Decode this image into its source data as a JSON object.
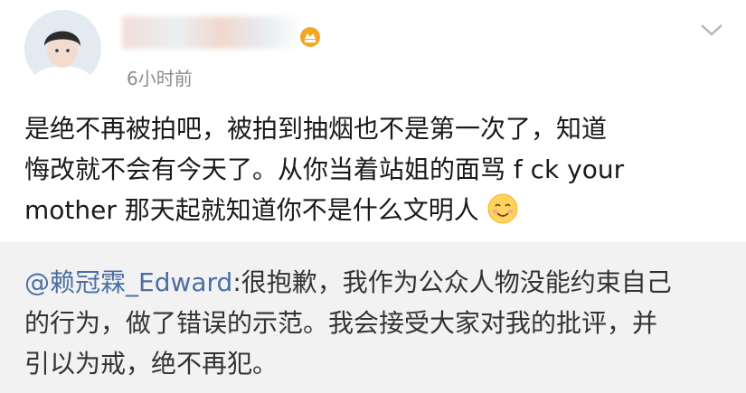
{
  "post": {
    "timestamp": "6小时前",
    "text_line1": "是绝不再被拍吧，被拍到抽烟也不是第一次了，知道",
    "text_line2": "悔改就不会有今天了。从你当着站姐的面骂 f ck your",
    "text_line3": "mother 那天起就知道你不是什么文明人",
    "emoji": "smiling-face-emoji"
  },
  "repost": {
    "mention": "@赖冠霖_Edward",
    "line1_rest": ":很抱歉，我作为公众人物没能约束自己",
    "line2": "的行为，做了错误的示范。我会接受大家对我的批评，并",
    "line3": "引以为戒，绝不再犯。"
  },
  "colors": {
    "mention": "#4a6fa5",
    "repost_bg": "#f2f2f2",
    "timestamp": "#8c8c8c"
  }
}
